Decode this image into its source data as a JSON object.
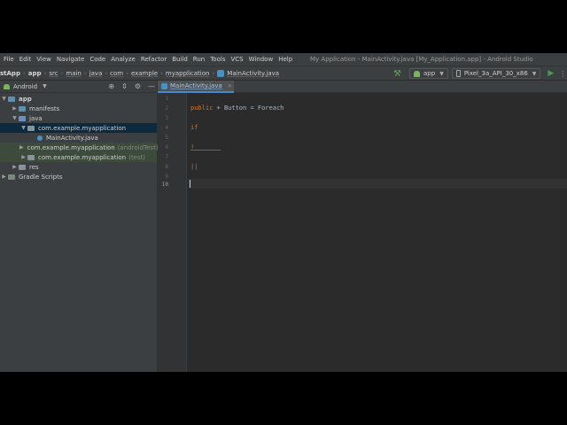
{
  "window_title": "My Application - MainActivity.java [My_Application.app] - Android Studio",
  "menu": [
    "File",
    "Edit",
    "View",
    "Navigate",
    "Code",
    "Analyze",
    "Refactor",
    "Build",
    "Run",
    "Tools",
    "VCS",
    "Window",
    "Help"
  ],
  "breadcrumbs": [
    "stApp",
    "app",
    "src",
    "main",
    "java",
    "com",
    "example",
    "myapplication",
    "MainActivity.java"
  ],
  "toolbar": {
    "config": "app",
    "device": "Pixel_3a_API_30_x86"
  },
  "project": {
    "view": "Android",
    "tree": {
      "app": "app",
      "manifests": "manifests",
      "java": "java",
      "pkg_main": "com.example.myapplication",
      "main_activity": "MainActivity.java",
      "pkg_android_test": "com.example.myapplication",
      "pkg_android_test_suffix": "(androidTest)",
      "pkg_test": "com.example.myapplication",
      "pkg_test_suffix": "(test)",
      "res": "res",
      "gradle": "Gradle Scripts"
    }
  },
  "editor": {
    "tab": "MainActivity.java",
    "line_numbers": [
      "1",
      "2",
      "3",
      "4",
      "5",
      "6",
      "7",
      "8",
      "9",
      "10"
    ],
    "current_line": 10,
    "code": {
      "l2_kw": "public",
      "l2_rest": " + Button = Foreach",
      "l4": "if",
      "l6": "!",
      "l8": "||"
    }
  },
  "colors": {
    "keyword": "#cc7832",
    "plain": "#a9b7c6",
    "selection": "#0d293e",
    "error": "#bc3f3c"
  }
}
